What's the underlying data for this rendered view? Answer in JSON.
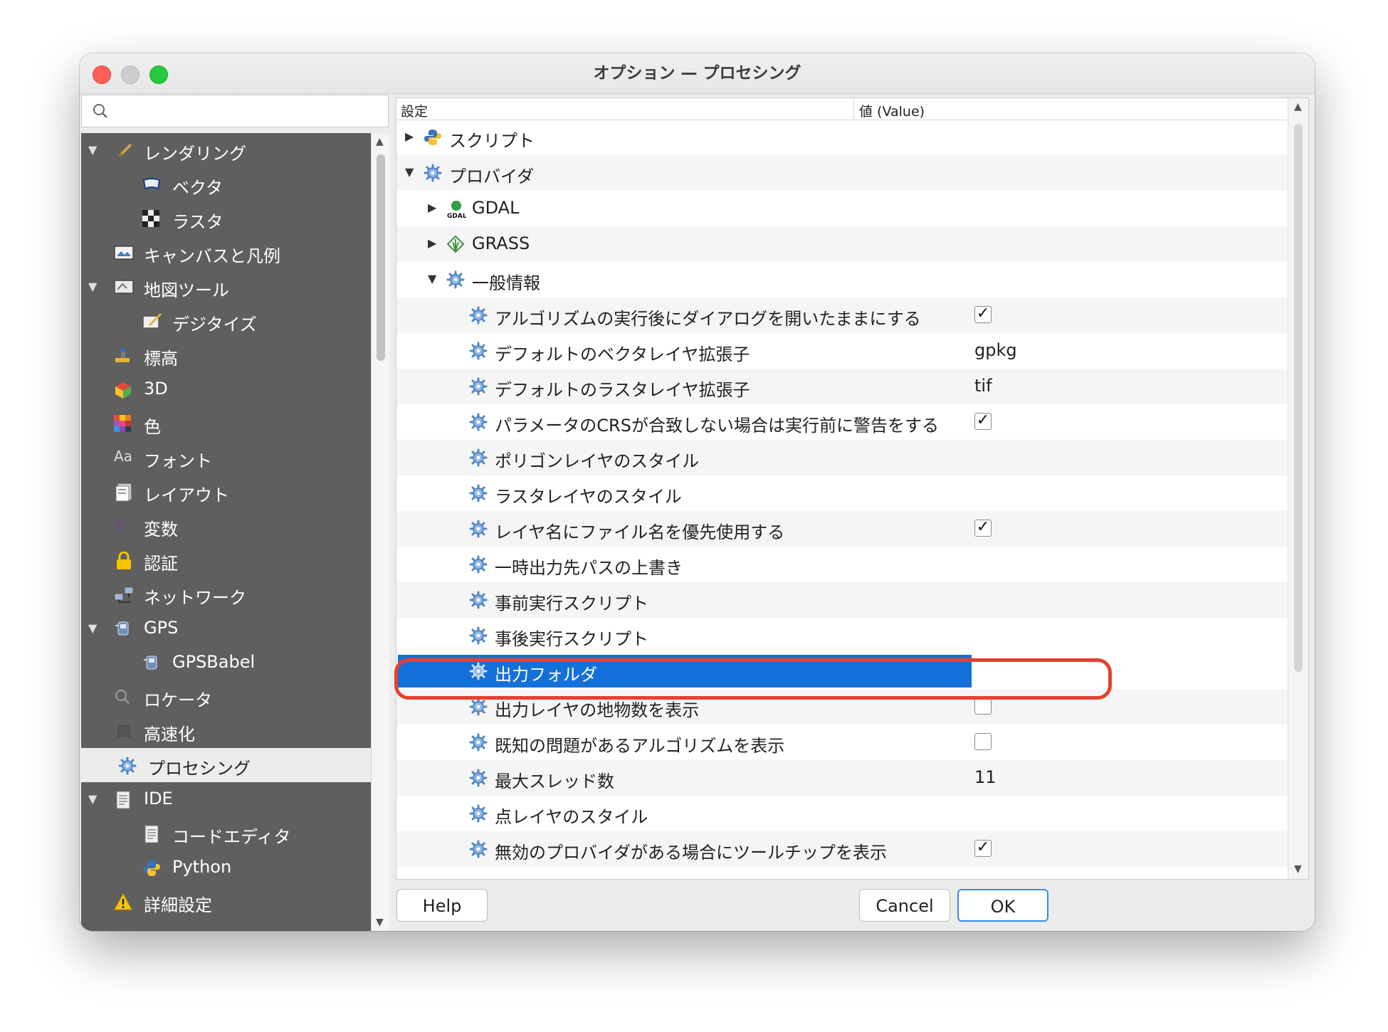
{
  "window": {
    "title": "オプション — プロセシング"
  },
  "search": {
    "placeholder": ""
  },
  "sidebar": {
    "items": [
      {
        "label": "レンダリング",
        "icon": "brush-icon"
      },
      {
        "label": "ベクタ",
        "icon": "vector-icon"
      },
      {
        "label": "ラスタ",
        "icon": "raster-icon"
      },
      {
        "label": "キャンバスと凡例",
        "icon": "canvas-icon"
      },
      {
        "label": "地図ツール",
        "icon": "map-tools-icon"
      },
      {
        "label": "デジタイズ",
        "icon": "digitize-icon"
      },
      {
        "label": "標高",
        "icon": "elevation-icon"
      },
      {
        "label": "3D",
        "icon": "cube-icon"
      },
      {
        "label": "色",
        "icon": "color-grid-icon"
      },
      {
        "label": "フォント",
        "icon": "font-icon"
      },
      {
        "label": "レイアウト",
        "icon": "layout-icon"
      },
      {
        "label": "変数",
        "icon": "variables-icon"
      },
      {
        "label": "認証",
        "icon": "lock-icon"
      },
      {
        "label": "ネットワーク",
        "icon": "network-icon"
      },
      {
        "label": "GPS",
        "icon": "gps-icon"
      },
      {
        "label": "GPSBabel",
        "icon": "gps-icon"
      },
      {
        "label": "ロケータ",
        "icon": "search-icon"
      },
      {
        "label": "高速化",
        "icon": "chip-icon"
      },
      {
        "label": "プロセシング",
        "icon": "gear-icon"
      },
      {
        "label": "IDE",
        "icon": "document-icon"
      },
      {
        "label": "コードエディタ",
        "icon": "document-icon"
      },
      {
        "label": "Python",
        "icon": "python-icon"
      },
      {
        "label": "詳細設定",
        "icon": "warning-icon"
      }
    ]
  },
  "table": {
    "col_setting": "設定",
    "col_value": "値 (Value)",
    "rows": [
      {
        "label": "スクリプト"
      },
      {
        "label": "プロバイダ"
      },
      {
        "label": "GDAL"
      },
      {
        "label": "GRASS"
      },
      {
        "label": "一般情報"
      },
      {
        "label": "アルゴリズムの実行後にダイアログを開いたままにする",
        "checked": true
      },
      {
        "label": "デフォルトのベクタレイヤ拡張子",
        "value": "gpkg"
      },
      {
        "label": "デフォルトのラスタレイヤ拡張子",
        "value": "tif"
      },
      {
        "label": "パラメータのCRSが合致しない場合は実行前に警告をする",
        "checked": true
      },
      {
        "label": "ポリゴンレイヤのスタイル"
      },
      {
        "label": "ラスタレイヤのスタイル"
      },
      {
        "label": "レイヤ名にファイル名を優先使用する",
        "checked": true
      },
      {
        "label": "一時出力先パスの上書き"
      },
      {
        "label": "事前実行スクリプト"
      },
      {
        "label": "事後実行スクリプト"
      },
      {
        "label": "出力フォルダ"
      },
      {
        "label": "出力レイヤの地物数を表示",
        "checked": false
      },
      {
        "label": "既知の問題があるアルゴリズムを表示",
        "checked": false
      },
      {
        "label": "最大スレッド数",
        "value": "11"
      },
      {
        "label": "点レイヤのスタイル"
      },
      {
        "label": "無効のプロバイダがある場合にツールチップを表示",
        "checked": true
      }
    ]
  },
  "buttons": {
    "help": "Help",
    "cancel": "Cancel",
    "ok": "OK"
  },
  "colors": {
    "selection": "#1470d9",
    "highlight_outline": "#e8402f",
    "sidebar_bg": "#5f5f5f"
  }
}
